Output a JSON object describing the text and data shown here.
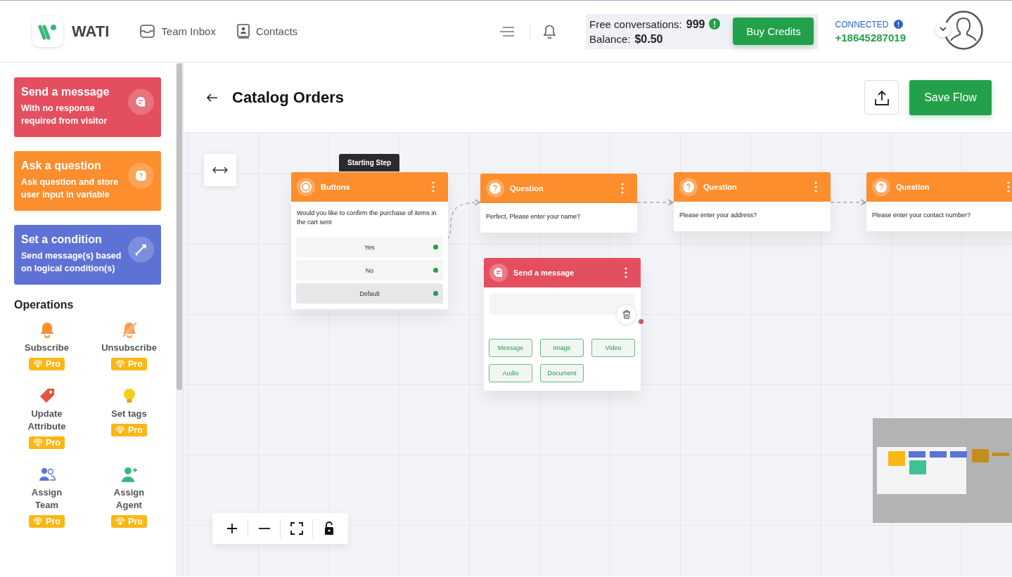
{
  "header": {
    "brand": "WATI",
    "nav": [
      {
        "label": "Team Inbox",
        "kind": "inbox"
      },
      {
        "label": "Contacts",
        "kind": "contacts"
      }
    ],
    "credits": {
      "free_label": "Free conversations:",
      "free_count": "999",
      "balance_label": "Balance:",
      "balance": "$0.50"
    },
    "buy_button": "Buy Credits",
    "status": "CONNECTED",
    "phone": "+18645287019"
  },
  "sidebar": {
    "cards": [
      {
        "title": "Send a message",
        "subtitle": "With no response required from visitor",
        "color": "#e44f5f",
        "kind": "message"
      },
      {
        "title": "Ask a question",
        "subtitle": "Ask question and store user input in variable",
        "color": "#fd8e2e",
        "kind": "question"
      },
      {
        "title": "Set a condition",
        "subtitle": "Send message(s) based on logical condition(s)",
        "color": "#5e72d6",
        "kind": "condition"
      }
    ],
    "operations_title": "Operations",
    "operations": [
      {
        "label": "Subscribe",
        "kind": "bell",
        "badge": "Pro"
      },
      {
        "label": "Unsubscribe",
        "kind": "bell-off",
        "badge": "Pro"
      },
      {
        "label": "Update Attribute",
        "kind": "tag",
        "badge": "Pro"
      },
      {
        "label": "Set tags",
        "kind": "bulb",
        "badge": "Pro"
      },
      {
        "label": "Assign Team",
        "kind": "team",
        "badge": "Pro"
      },
      {
        "label": "Assign Agent",
        "kind": "agent",
        "badge": "Pro"
      }
    ]
  },
  "flow": {
    "title": "Catalog Orders",
    "save_button": "Save Flow"
  },
  "canvas": {
    "start_tag": "Starting Step",
    "nodes": [
      {
        "kind": "buttons",
        "title": "Buttons",
        "text": "Would you like to confirm the purchase of items in the cart sent",
        "buttons": [
          {
            "label": "Yes",
            "selected": false
          },
          {
            "label": "No",
            "selected": false
          },
          {
            "label": "Default",
            "selected": true
          }
        ]
      },
      {
        "kind": "question",
        "title": "Question",
        "text": "Perfect, Please enter your name?"
      },
      {
        "kind": "question",
        "title": "Question",
        "text": "Please enter your address?"
      },
      {
        "kind": "question",
        "title": "Question",
        "text": "Please enter your contact number?"
      },
      {
        "kind": "message",
        "title": "Send a message",
        "options": [
          "Message",
          "Image",
          "Video",
          "Audio",
          "Document"
        ]
      }
    ]
  }
}
